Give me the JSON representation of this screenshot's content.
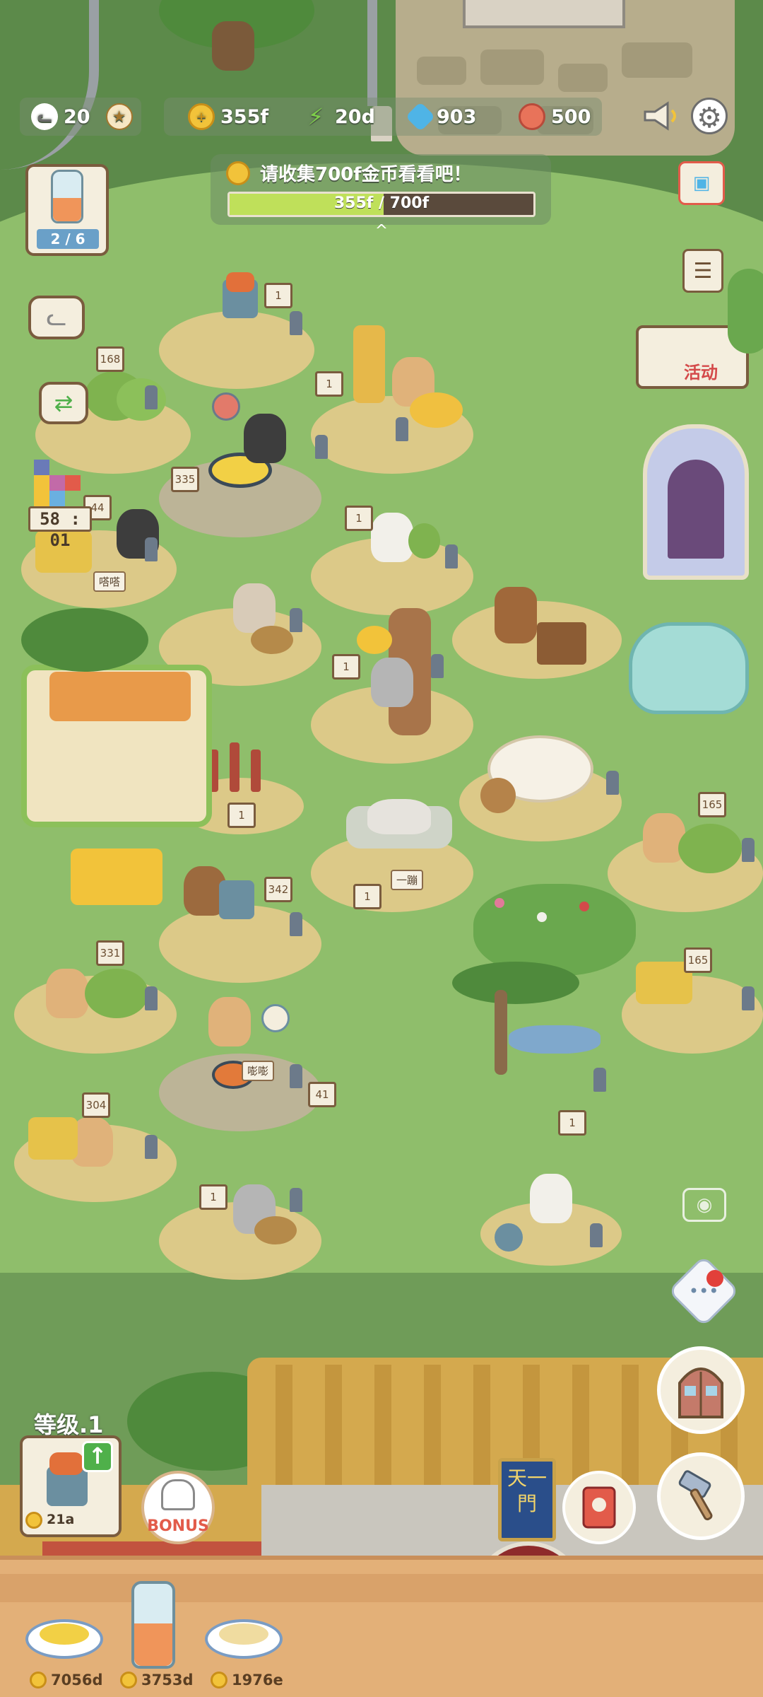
{
  "hud": {
    "cats": "20",
    "coins": "355f",
    "energy": "20d",
    "gems": "903",
    "fish": "500"
  },
  "quest": {
    "text": "请收集700f金币看看吧！",
    "progress_text": "355f / 700f",
    "progress_fraction": 0.507
  },
  "bottle_count": "2 / 6",
  "timer": "58 : 01",
  "level": {
    "label": "等级.1",
    "cost": "21a"
  },
  "bonus_label": "BONUS",
  "gate_sign": "天一門",
  "counter": {
    "items": [
      {
        "value": "7056d",
        "food": "corn-soup"
      },
      {
        "value": "3753d",
        "food": "juice-jar"
      },
      {
        "value": "1976e",
        "food": "nuts"
      }
    ]
  },
  "signs": [
    "1",
    "168",
    "1",
    "1",
    "335",
    "44",
    "1",
    "1",
    "1",
    "165",
    "342",
    "1",
    "331",
    "165",
    "304",
    "41",
    "1",
    "1"
  ],
  "tags": {
    "eat": "嗒嗒",
    "sleep": "一蹦",
    "eat2": "嘭嘭",
    "activity": "活动"
  },
  "colors": {
    "lawn": "#8fbe6b",
    "progress_fill": "#bfe05a",
    "coin": "#f2c33a"
  }
}
